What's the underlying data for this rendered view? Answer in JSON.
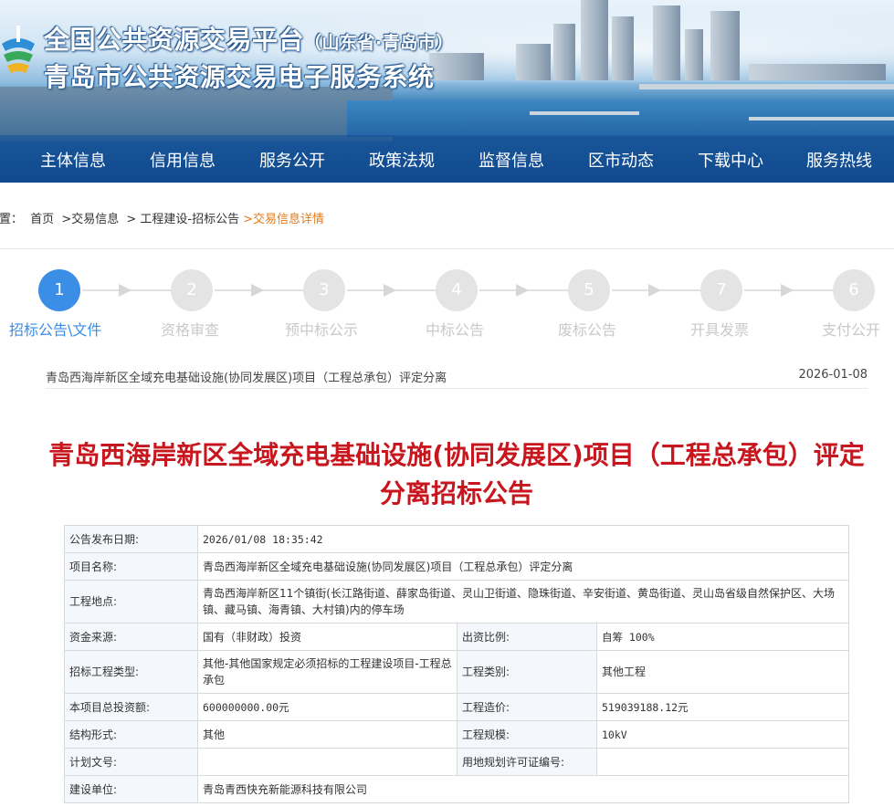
{
  "header": {
    "title_main": "全国公共资源交易平台",
    "title_region": "（山东省·青岛市）",
    "title_system": "青岛市公共资源交易电子服务系统",
    "logo_icon": "platform-logo-icon"
  },
  "nav": {
    "items": [
      {
        "label": "主体信息"
      },
      {
        "label": "信用信息"
      },
      {
        "label": "服务公开"
      },
      {
        "label": "政策法规"
      },
      {
        "label": "监督信息"
      },
      {
        "label": "区市动态"
      },
      {
        "label": "下载中心"
      },
      {
        "label": "服务热线"
      }
    ]
  },
  "breadcrumb": {
    "prefix": "位置：",
    "items": [
      "首页",
      ">交易信息",
      "> 工程建设-招标公告",
      ">交易信息详情"
    ]
  },
  "steps": [
    {
      "num": "1",
      "label": "招标公告\\文件",
      "active": true
    },
    {
      "num": "2",
      "label": "资格审查",
      "active": false
    },
    {
      "num": "3",
      "label": "预中标公示",
      "active": false
    },
    {
      "num": "4",
      "label": "中标公告",
      "active": false
    },
    {
      "num": "5",
      "label": "废标公告",
      "active": false
    },
    {
      "num": "7",
      "label": "开具发票",
      "active": false
    },
    {
      "num": "6",
      "label": "支付公开",
      "active": false
    }
  ],
  "notice": {
    "title": "青岛西海岸新区全域充电基础设施(协同发展区)项目（工程总承包）评定分离",
    "date": "2026-01-08"
  },
  "main_title": "青岛西海岸新区全域充电基础设施(协同发展区)项目（工程总承包）评定分离招标公告",
  "table": {
    "publish_date_label": "公告发布日期:",
    "publish_date": "2026/01/08 18:35:42",
    "project_name_label": "项目名称:",
    "project_name": "青岛西海岸新区全域充电基础设施(协同发展区)项目（工程总承包）评定分离",
    "location_label": "工程地点:",
    "location": "青岛西海岸新区11个镇街(长江路街道、薛家岛街道、灵山卫街道、隐珠街道、辛安街道、黄岛街道、灵山岛省级自然保护区、大场镇、藏马镇、海青镇、大村镇)内的停车场",
    "fund_source_label": "资金来源:",
    "fund_source": "国有（非财政）投资",
    "fund_ratio_label": "出资比例:",
    "fund_ratio": "自筹 100%",
    "bid_type_label": "招标工程类型:",
    "bid_type": "其他-其他国家规定必须招标的工程建设项目-工程总承包",
    "project_category_label": "工程类别:",
    "project_category": "其他工程",
    "total_investment_label": "本项目总投资额:",
    "total_investment": "600000000.00元",
    "project_cost_label": "工程造价:",
    "project_cost": "519039188.12元",
    "structure_label": "结构形式:",
    "structure": "其他",
    "scale_label": "工程规模:",
    "scale": "10kV",
    "plan_doc_label": "计划文号:",
    "plan_doc": "",
    "land_permit_label": "用地规划许可证编号:",
    "land_permit": "",
    "builder_label": "建设单位:",
    "builder": "青岛青西快充新能源科技有限公司"
  },
  "colors": {
    "accent_blue": "#3a8ee6",
    "title_red": "#c8161e",
    "breadcrumb_current": "#e07b1a"
  }
}
